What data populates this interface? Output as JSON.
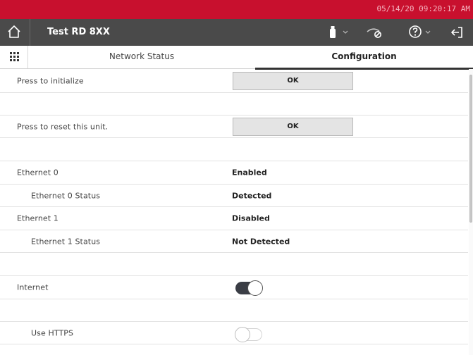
{
  "status_bar": {
    "datetime": "05/14/20 09:20:17 AM"
  },
  "header": {
    "title": "Test RD 8XX",
    "icons": [
      "home-icon",
      "usb-icon",
      "chevron-down-icon",
      "network-off-icon",
      "help-icon",
      "logout-icon"
    ]
  },
  "tabs": [
    {
      "label": "Network Status",
      "active": false
    },
    {
      "label": "Configuration",
      "active": true
    }
  ],
  "rows": {
    "initialize": {
      "label": "Press to initialize",
      "button": "OK"
    },
    "reset": {
      "label": "Press to reset this unit.",
      "button": "OK"
    },
    "eth0": {
      "label": "Ethernet 0",
      "value": "Enabled"
    },
    "eth0_status": {
      "label": "Ethernet 0 Status",
      "value": "Detected"
    },
    "eth1": {
      "label": "Ethernet 1",
      "value": "Disabled"
    },
    "eth1_status": {
      "label": "Ethernet 1 Status",
      "value": "Not Detected"
    },
    "internet": {
      "label": "Internet",
      "toggle": true
    },
    "https": {
      "label": "Use HTTPS",
      "toggle": false
    }
  },
  "colors": {
    "status_bar": "#c8102e",
    "header": "#4a4a4a",
    "toggle_on": "#3a3d45"
  }
}
